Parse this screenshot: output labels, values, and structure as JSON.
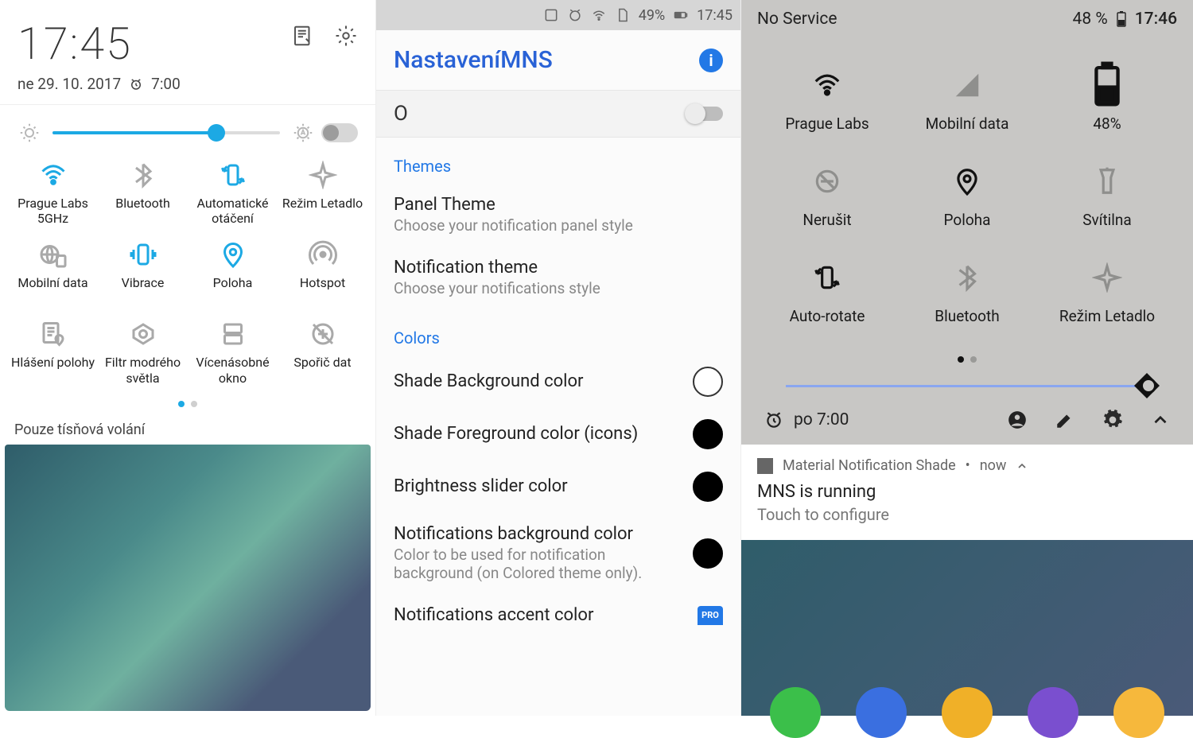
{
  "pane1": {
    "clock": "17:45",
    "date": "ne 29. 10. 2017",
    "alarm": "7:00",
    "brightness_pct": 72,
    "auto_brightness": false,
    "tiles": [
      {
        "label": "Prague Labs 5GHz",
        "icon": "wifi",
        "on": true
      },
      {
        "label": "Bluetooth",
        "icon": "bluetooth",
        "on": false
      },
      {
        "label": "Automatické otáčení",
        "icon": "rotate",
        "on": true
      },
      {
        "label": "Režim Letadlo",
        "icon": "airplane",
        "on": false
      },
      {
        "label": "Mobilní data",
        "icon": "mobiledata",
        "on": false
      },
      {
        "label": "Vibrace",
        "icon": "vibrate",
        "on": true
      },
      {
        "label": "Poloha",
        "icon": "location",
        "on": true
      },
      {
        "label": "Hotspot",
        "icon": "hotspot",
        "on": false
      },
      {
        "label": "Hlášení polohy",
        "icon": "locreport",
        "on": false
      },
      {
        "label": "Filtr modrého světla",
        "icon": "bluefilter",
        "on": false
      },
      {
        "label": "Vícenásobné okno",
        "icon": "multiwindow",
        "on": false
      },
      {
        "label": "Spořič dat",
        "icon": "datasaver",
        "on": false
      }
    ],
    "pages": {
      "count": 2,
      "active": 0
    },
    "emergency": "Pouze tísňová volání"
  },
  "pane2": {
    "statusbar": {
      "battery": "49%",
      "time": "17:45"
    },
    "title": "NastaveníMNS",
    "enable": {
      "label": "O",
      "on": false
    },
    "section_themes": "Themes",
    "items_themes": [
      {
        "t1": "Panel Theme",
        "t2": "Choose your notification panel style"
      },
      {
        "t1": "Notification theme",
        "t2": "Choose your notifications style"
      }
    ],
    "section_colors": "Colors",
    "items_colors": [
      {
        "t1": "Shade Background color",
        "swatch": "#ffffff"
      },
      {
        "t1": "Shade Foreground color (icons)",
        "swatch": "#000000"
      },
      {
        "t1": "Brightness slider color",
        "swatch": "#000000"
      },
      {
        "t1": "Notifications background color",
        "t2": "Color to be used for notification background (on Colored theme only).",
        "swatch": "#000000"
      },
      {
        "t1": "Notifications accent color",
        "pro": "PRO"
      }
    ]
  },
  "pane3": {
    "statusbar": {
      "service": "No Service",
      "battery": "48 %",
      "time": "17:46"
    },
    "tiles": [
      {
        "label": "Prague Labs",
        "icon": "wifi",
        "on": true
      },
      {
        "label": "Mobilní data",
        "icon": "signal",
        "on": false
      },
      {
        "label": "48%",
        "icon": "battery",
        "on": true
      },
      {
        "label": "Nerušit",
        "icon": "dnd",
        "on": false
      },
      {
        "label": "Poloha",
        "icon": "location",
        "on": true
      },
      {
        "label": "Svítilna",
        "icon": "flashlight",
        "on": false
      },
      {
        "label": "Auto-rotate",
        "icon": "rotate",
        "on": true
      },
      {
        "label": "Bluetooth",
        "icon": "bluetooth",
        "on": false
      },
      {
        "label": "Režim Letadlo",
        "icon": "airplane",
        "on": false
      }
    ],
    "pages": {
      "count": 2,
      "active": 0
    },
    "footer": {
      "alarm": "po 7:00"
    },
    "notification": {
      "app": "Material Notification Shade",
      "time": "now",
      "title": "MNS is running",
      "subtitle": "Touch to configure"
    },
    "dock_colors": [
      "#3bbf4a",
      "#3a6fe0",
      "#f0b028",
      "#7a4fcf",
      "#f6b83c"
    ]
  }
}
